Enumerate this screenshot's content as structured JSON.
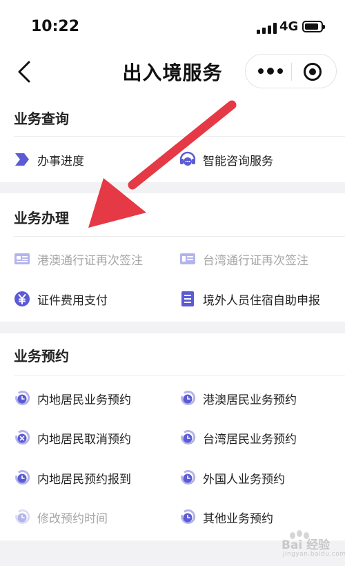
{
  "status": {
    "time": "10:22",
    "network": "4G"
  },
  "nav": {
    "title": "出入境服务"
  },
  "sections": [
    {
      "title": "业务查询",
      "items": [
        {
          "label": "办事进度",
          "icon": "progress-icon"
        },
        {
          "label": "智能咨询服务",
          "icon": "chat-icon"
        }
      ]
    },
    {
      "title": "业务办理",
      "items": [
        {
          "label": "港澳通行证再次签注",
          "icon": "id-card-icon",
          "disabled": true
        },
        {
          "label": "台湾通行证再次签注",
          "icon": "tw-card-icon",
          "disabled": true
        },
        {
          "label": "证件费用支付",
          "icon": "yuan-icon"
        },
        {
          "label": "境外人员住宿自助申报",
          "icon": "document-icon"
        }
      ]
    },
    {
      "title": "业务预约",
      "items": [
        {
          "label": "内地居民业务预约",
          "icon": "clock-icon"
        },
        {
          "label": "港澳居民业务预约",
          "icon": "clock-icon"
        },
        {
          "label": "内地居民取消预约",
          "icon": "cancel-clock-icon"
        },
        {
          "label": "台湾居民业务预约",
          "icon": "clock-icon"
        },
        {
          "label": "内地居民预约报到",
          "icon": "clock-icon"
        },
        {
          "label": "外国人业务预约",
          "icon": "clock-icon"
        },
        {
          "label": "修改预约时间",
          "icon": "clock-icon",
          "disabled": true
        },
        {
          "label": "其他业务预约",
          "icon": "clock-icon"
        }
      ]
    }
  ],
  "watermark": {
    "text": "Bai 经验",
    "sub": "jingyan.baidu.com"
  },
  "colors": {
    "accent": "#5b5bd6",
    "accent_light": "#e1e1f7",
    "arrow": "#e53945",
    "disabled": "#a6a6a6"
  }
}
